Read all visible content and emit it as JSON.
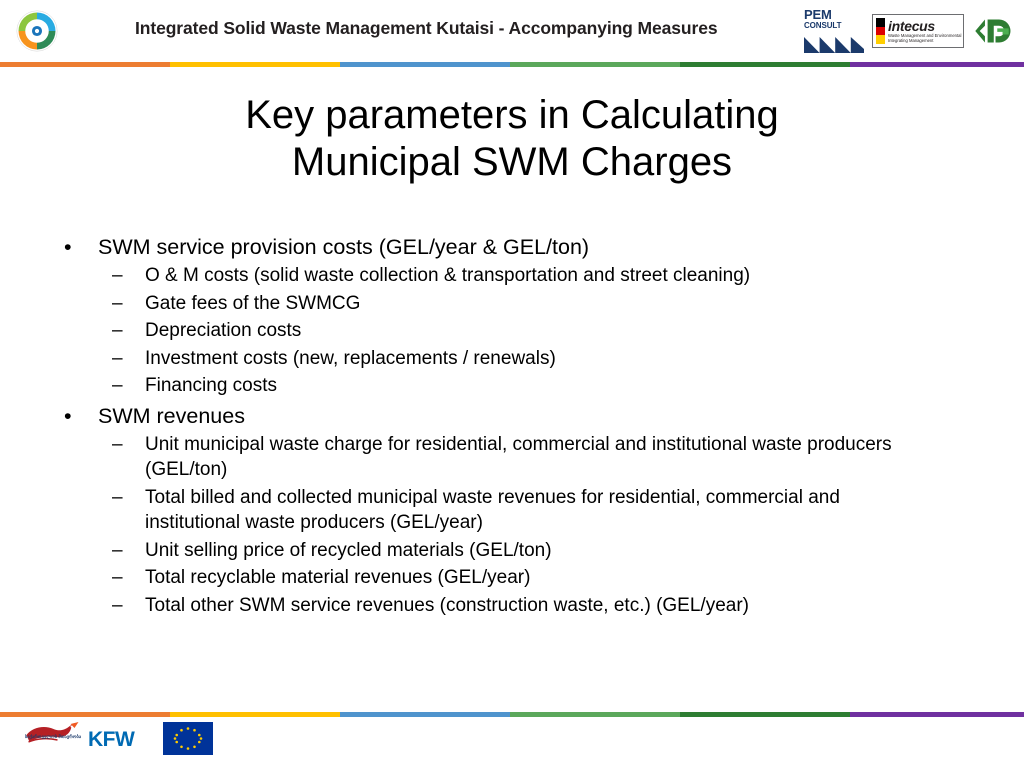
{
  "header": {
    "title": "Integrated Solid Waste Management Kutaisi - Accompanying Measures",
    "logos": {
      "pem_name": "PEM",
      "pem_sub": "CONSULT",
      "intecus_name": "intecus",
      "intecus_sub": "Waste Management and Environmental Integrating Management",
      "cg_name": "CG"
    }
  },
  "colorbar": {
    "colors": [
      "#ED7D31",
      "#FFC000",
      "#4F94CD",
      "#5BA85B",
      "#2E7D32",
      "#7030A0"
    ]
  },
  "slide": {
    "title_line1": "Key parameters in Calculating",
    "title_line2": "Municipal SWM Charges",
    "bullets": [
      {
        "level": 1,
        "marker": "•",
        "text": "SWM service provision costs (GEL/year & GEL/ton)"
      },
      {
        "level": 2,
        "marker": "–",
        "text": "O & M costs (solid waste collection & transportation and street cleaning)"
      },
      {
        "level": 2,
        "marker": "–",
        "text": "Gate fees of the SWMCG"
      },
      {
        "level": 2,
        "marker": "–",
        "text": "Depreciation costs"
      },
      {
        "level": 2,
        "marker": "–",
        "text": "Investment costs (new, replacements / renewals)"
      },
      {
        "level": 2,
        "marker": "–",
        "text": "Financing costs"
      },
      {
        "level": 1,
        "marker": "•",
        "text": "SWM revenues"
      },
      {
        "level": 2,
        "marker": "–",
        "text": "Unit municipal waste charge for residential, commercial and institutional waste producers (GEL/ton)"
      },
      {
        "level": 2,
        "marker": "–",
        "text": "Total billed and collected municipal waste revenues for residential, commercial and institutional waste producers (GEL/year)"
      },
      {
        "level": 2,
        "marker": "–",
        "text": "Unit selling price of recycled materials (GEL/ton)"
      },
      {
        "level": 2,
        "marker": "–",
        "text": "Total recyclable material revenues  (GEL/year)"
      },
      {
        "level": 2,
        "marker": "–",
        "text": "Total other SWM service revenues (construction waste, etc.)  (GEL/year)"
      }
    ]
  },
  "footer": {
    "geo_text": "საქართველოს მთავრობა",
    "kfw_label": "KFW",
    "eu_label": "European Union"
  }
}
